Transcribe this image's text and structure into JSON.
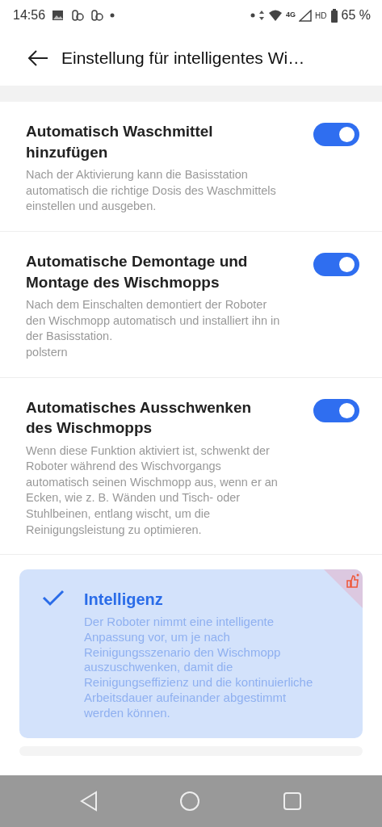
{
  "status_bar": {
    "time": "14:56",
    "network": "4G",
    "hd": "HD",
    "battery": "65 %"
  },
  "header": {
    "title": "Einstellung für intelligentes Wi…"
  },
  "settings": [
    {
      "title": "Automatisch Waschmittel hinzufügen",
      "description": "Nach der Aktivierung kann die Basisstation automatisch die richtige Dosis des Waschmittels einstellen und ausgeben.",
      "on": true
    },
    {
      "title": "Automatische Demontage und Montage des Wischmopps",
      "description": "Nach dem Einschalten demontiert der Roboter den Wischmopp automatisch und installiert ihn in der Basisstation.\npolstern",
      "on": true
    },
    {
      "title": "Automatisches Ausschwenken des Wischmopps",
      "description": "Wenn diese Funktion aktiviert ist, schwenkt der Roboter während des Wischvorgangs automatisch seinen Wischmopp aus, wenn er an Ecken, wie z. B. Wänden und Tisch- oder Stuhlbeinen, entlang wischt, um die Reinigungsleistung zu optimieren.",
      "on": true
    }
  ],
  "options": [
    {
      "title": "Intelligenz",
      "description": "Der Roboter nimmt eine intelligente Anpassung vor, um je nach Reinigungsszenario den Wischmopp auszuschwenken, damit die Reinigungseffizienz und die kontinuierliche Arbeitsdauer aufeinander abgestimmt werden können.",
      "selected": true,
      "recommended": true
    }
  ]
}
